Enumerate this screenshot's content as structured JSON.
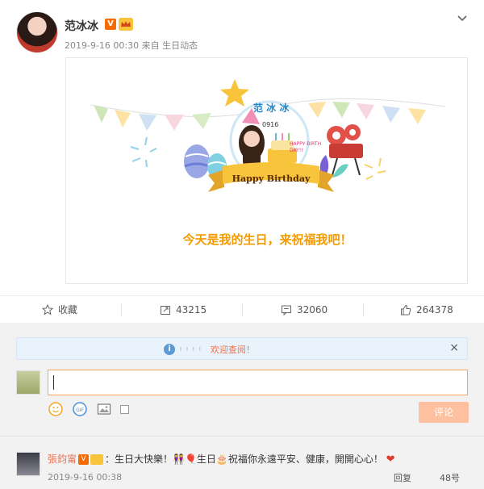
{
  "post": {
    "username": "范冰冰",
    "verified_badge": "V",
    "member_badge": "👑",
    "timestamp": "2019-9-16 00:30",
    "source_prefix": "来自",
    "source": "生日动态"
  },
  "card": {
    "name_text": "范 冰 冰",
    "date_text": "0916",
    "cake_text": "HAPPY BIRTH DAY!!",
    "banner_text": "Happy Birthday",
    "message": "今天是我的生日，来祝福我吧！",
    "colors": {
      "accent": "#f39b00",
      "banner": "#f7c43b"
    }
  },
  "actions": {
    "favorite_label": "收藏",
    "repost_count": "43215",
    "comment_count": "32060",
    "like_count": "264378"
  },
  "comment_box": {
    "notice_text": "欢迎查阅！",
    "notice_close": "×",
    "input_value": "",
    "submit_label": "评论"
  },
  "comment": {
    "username": "張鈞甯",
    "text": "：生日大快樂！👭🎈生日🎂祝福你永遠平安、健康，開開心心！",
    "timestamp": "2019-9-16 00:38",
    "reply_label": "回复",
    "like_label": "48号"
  }
}
